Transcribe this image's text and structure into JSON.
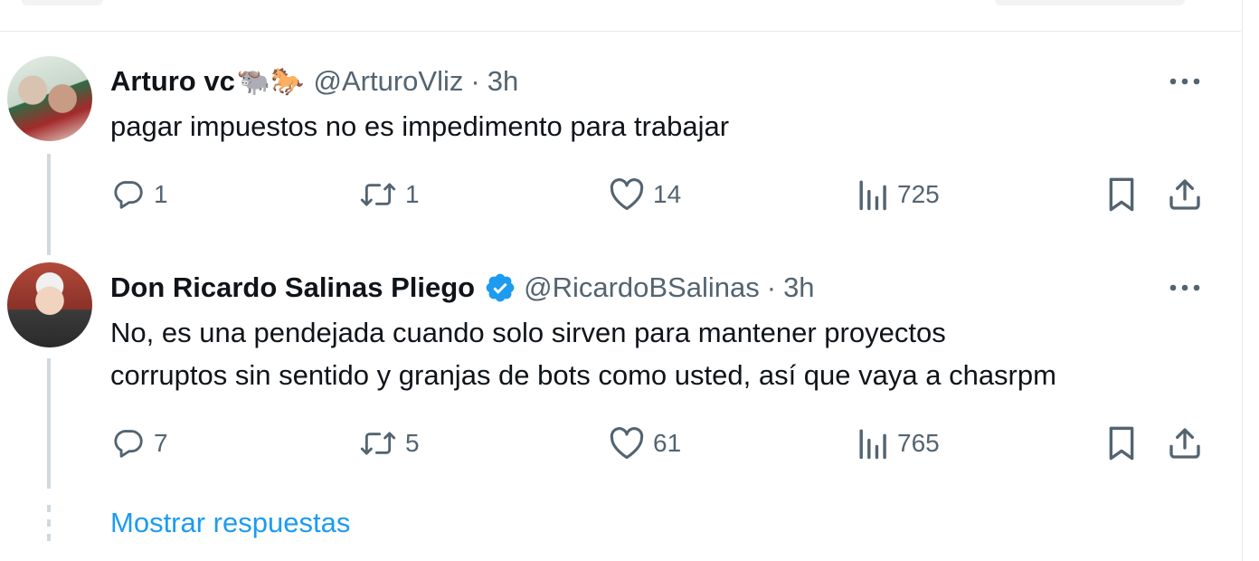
{
  "colors": {
    "accent": "#1d9bf0",
    "secondary_text": "#536471",
    "primary_text": "#0f1419",
    "thread_line": "#cfd9de"
  },
  "tweets": [
    {
      "name": "Arturo vc",
      "name_emojis": "🐃🐎",
      "handle": "@ArturoVliz",
      "separator": "·",
      "time": "3h",
      "verified": false,
      "text_lines": [
        "pagar impuestos no es impedimento para trabajar"
      ],
      "stats": {
        "replies": "1",
        "retweets": "1",
        "likes": "14",
        "views": "725"
      }
    },
    {
      "name": "Don Ricardo Salinas Pliego",
      "handle": "@RicardoBSalinas",
      "separator": "·",
      "time": "3h",
      "verified": true,
      "text_lines": [
        "No, es una pendejada cuando solo sirven para mantener proyectos",
        "corruptos sin sentido y granjas de bots como usted, así que vaya a chasrpm"
      ],
      "stats": {
        "replies": "7",
        "retweets": "5",
        "likes": "61",
        "views": "765"
      }
    }
  ],
  "show_replies_label": "Mostrar respuestas"
}
